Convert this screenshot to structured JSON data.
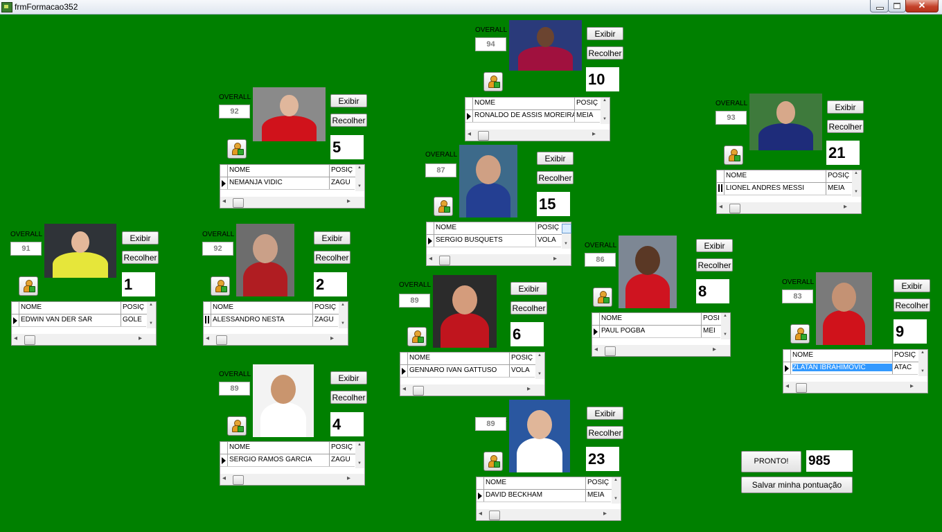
{
  "window": {
    "title": "frmFormacao352",
    "controls": {
      "minimize": "minimize-icon",
      "maximize": "maximize-icon",
      "close": "close-icon",
      "close_glyph": "✕"
    }
  },
  "labels": {
    "overall": "OVERALL",
    "exibir": "Exibir",
    "recolher": "Recolher",
    "col_nome": "NOME",
    "col_posicao": "POSIÇ"
  },
  "players": [
    {
      "id": "gk",
      "overall": "91",
      "number": "1",
      "name": "EDWIN VAN DER SAR",
      "position": "GOLE",
      "photo": {
        "bg": "#2f3338",
        "shirt": "#e6e63a",
        "skin": "#e4b89a"
      }
    },
    {
      "id": "nesta",
      "overall": "92",
      "number": "2",
      "name": "ALESSANDRO NESTA",
      "position": "ZAGU",
      "photo": {
        "bg": "#6d6d6d",
        "shirt": "#b01d22",
        "skin": "#caa088"
      }
    },
    {
      "id": "vidic",
      "overall": "92",
      "number": "5",
      "name": "NEMANJA VIDIC",
      "position": "ZAGU",
      "photo": {
        "bg": "#8a8a8a",
        "shirt": "#d0121b",
        "skin": "#e0b79c"
      }
    },
    {
      "id": "ramos",
      "overall": "89",
      "number": "4",
      "name": "SERGIO RAMOS GARCIA",
      "position": "ZAGU",
      "photo": {
        "bg": "#f3f3f3",
        "shirt": "#ffffff",
        "skin": "#c9956e"
      }
    },
    {
      "id": "ronaldinho",
      "overall": "94",
      "number": "10",
      "name": "RONALDO DE ASSIS MOREIRA",
      "position": "MEIA",
      "photo": {
        "bg": "#2a3a7a",
        "shirt": "#a0113e",
        "skin": "#6b4430"
      }
    },
    {
      "id": "busquets",
      "overall": "87",
      "number": "15",
      "name": "SERGIO BUSQUETS",
      "position": "VOLA",
      "photo": {
        "bg": "#3d6a8a",
        "shirt": "#243f92",
        "skin": "#cfa084"
      }
    },
    {
      "id": "gattuso",
      "overall": "89",
      "number": "6",
      "name": "GENNARO IVAN GATTUSO",
      "position": "VOLA",
      "photo": {
        "bg": "#2b2b2b",
        "shirt": "#c0151e",
        "skin": "#d49c7c"
      }
    },
    {
      "id": "beckham",
      "overall": "89",
      "number": "23",
      "name": "DAVID BECKHAM",
      "position": "MEIA",
      "photo": {
        "bg": "#2a57a0",
        "shirt": "#ffffff",
        "skin": "#e0b699"
      }
    },
    {
      "id": "messi",
      "overall": "93",
      "number": "21",
      "name": "LIONEL ANDRÉS MESSI",
      "position": "MEIA",
      "photo": {
        "bg": "#3e7a3c",
        "shirt": "#1e2c7a",
        "skin": "#d7a88a"
      }
    },
    {
      "id": "pogba",
      "overall": "86",
      "number": "8",
      "name": "PAUL POGBA",
      "position": "MEI",
      "photo": {
        "bg": "#7d8794",
        "shirt": "#cf1420",
        "skin": "#5a3825"
      }
    },
    {
      "id": "ibra",
      "overall": "83",
      "number": "9",
      "name": "ZLATAN IBRAHIMOVIC",
      "position": "ATAC",
      "photo": {
        "bg": "#7a7a7a",
        "shirt": "#d0121b",
        "skin": "#c49274"
      }
    }
  ],
  "footer": {
    "pronto_label": "PRONTO!",
    "score": "985",
    "save_label": "Salvar minha pontuação"
  },
  "icons": {
    "add_player": "add-player-icon",
    "row_indicator": "row-pointer-icon"
  }
}
